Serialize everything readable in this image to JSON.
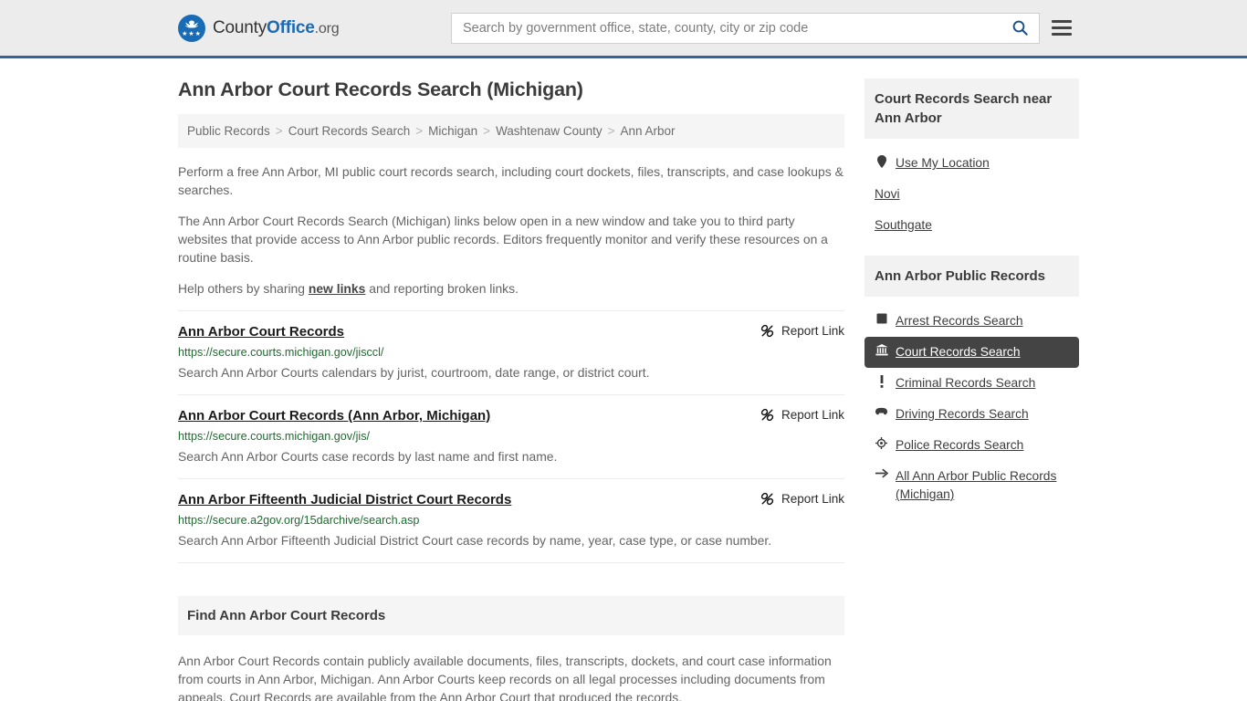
{
  "header": {
    "logo": {
      "part1": "County",
      "part2": "Office",
      "part3": ".org",
      "icon": "eagle-seal-icon"
    },
    "search": {
      "placeholder": "Search by government office, state, county, city or zip code",
      "value": "",
      "icon": "search-icon"
    },
    "menu_icon": "hamburger-menu-icon",
    "accent_color": "#31679e"
  },
  "page": {
    "title": "Ann Arbor Court Records Search (Michigan)"
  },
  "breadcrumb": {
    "separator": ">",
    "items": [
      {
        "label": "Public Records"
      },
      {
        "label": "Court Records Search"
      },
      {
        "label": "Michigan"
      },
      {
        "label": "Washtenaw County"
      },
      {
        "label": "Ann Arbor"
      }
    ]
  },
  "intro": {
    "p1": "Perform a free Ann Arbor, MI public court records search, including court dockets, files, transcripts, and case lookups & searches.",
    "p2": "The Ann Arbor Court Records Search (Michigan) links below open in a new window and take you to third party websites that provide access to Ann Arbor public records. Editors frequently monitor and verify these resources on a routine basis.",
    "p3_before": "Help others by sharing ",
    "p3_link": "new links",
    "p3_after": " and reporting broken links."
  },
  "results": {
    "report_label": "Report Link",
    "report_icon": "broken-link-icon",
    "items": [
      {
        "title": "Ann Arbor Court Records",
        "url": "https://secure.courts.michigan.gov/jisccl/",
        "description": "Search Ann Arbor Courts calendars by jurist, courtroom, date range, or district court."
      },
      {
        "title": "Ann Arbor Court Records (Ann Arbor, Michigan)",
        "url": "https://secure.courts.michigan.gov/jis/",
        "description": "Search Ann Arbor Courts case records by last name and first name."
      },
      {
        "title": "Ann Arbor Fifteenth Judicial District Court Records",
        "url": "https://secure.a2gov.org/15darchive/search.asp",
        "description": "Search Ann Arbor Fifteenth Judicial District Court case records by name, year, case type, or case number."
      }
    ]
  },
  "find_section": {
    "heading": "Find Ann Arbor Court Records",
    "body": "Ann Arbor Court Records contain publicly available documents, files, transcripts, dockets, and court case information from courts in Ann Arbor, Michigan. Ann Arbor Courts keep records on all legal processes including documents from appeals. Court Records are available from the Ann Arbor Court that produced the records."
  },
  "sidebar": {
    "near_card": {
      "heading": "Court Records Search near Ann Arbor",
      "items": [
        {
          "label": "Use My Location",
          "icon": "location-pin-icon",
          "has_icon": true
        },
        {
          "label": "Novi",
          "icon": "",
          "has_icon": false
        },
        {
          "label": "Southgate",
          "icon": "",
          "has_icon": false
        }
      ]
    },
    "public_records_card": {
      "heading": "Ann Arbor Public Records",
      "active_color": "#444444",
      "items": [
        {
          "label": "Arrest Records Search",
          "icon": "fingerprint-icon",
          "active": false
        },
        {
          "label": "Court Records Search",
          "icon": "courthouse-icon",
          "active": true
        },
        {
          "label": "Criminal Records Search",
          "icon": "exclamation-icon",
          "active": false
        },
        {
          "label": "Driving Records Search",
          "icon": "car-icon",
          "active": false
        },
        {
          "label": "Police Records Search",
          "icon": "police-badge-icon",
          "active": false
        },
        {
          "label": "All Ann Arbor Public Records (Michigan)",
          "icon": "arrow-right-icon",
          "active": false
        }
      ]
    }
  }
}
